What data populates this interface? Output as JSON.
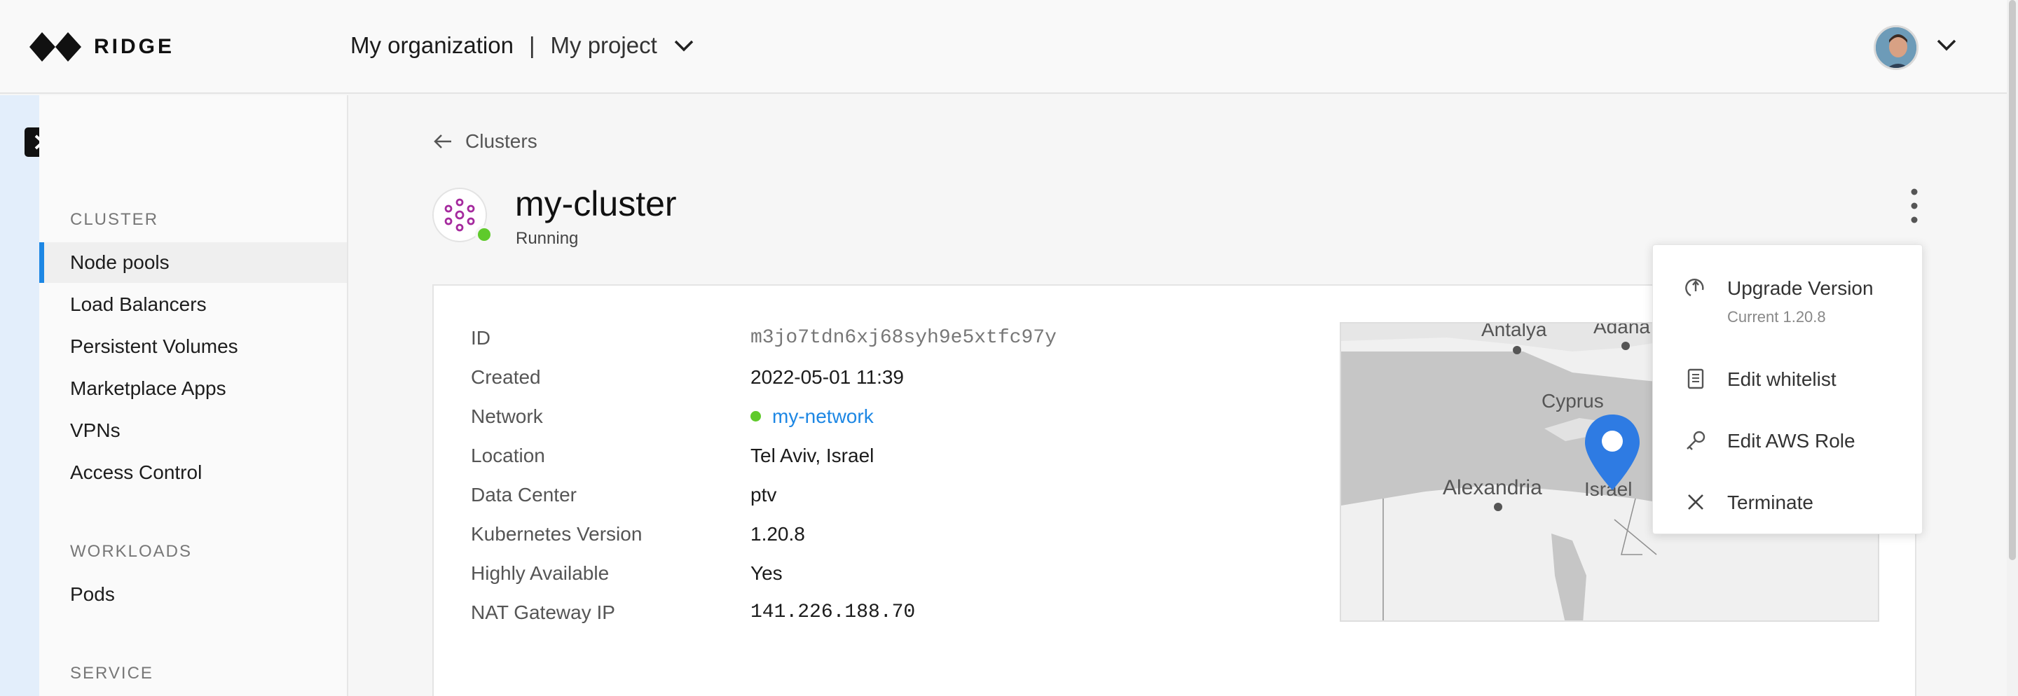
{
  "brand": {
    "name": "RIDGE"
  },
  "header": {
    "organization": "My organization",
    "separator": "|",
    "project": "My project"
  },
  "sidebar": {
    "sections": [
      {
        "title": "CLUSTER",
        "items": [
          "Node pools",
          "Load Balancers",
          "Persistent Volumes",
          "Marketplace Apps",
          "VPNs",
          "Access Control"
        ]
      },
      {
        "title": "WORKLOADS",
        "items": [
          "Pods"
        ]
      },
      {
        "title": "SERVICE",
        "items": []
      }
    ],
    "active_item": "Node pools"
  },
  "breadcrumb": {
    "back_label": "Clusters"
  },
  "cluster": {
    "name": "my-cluster",
    "status": "Running",
    "status_color": "#5fca2b"
  },
  "details": [
    {
      "label": "ID",
      "value": "m3jo7tdn6xj68syh9e5xtfc97y"
    },
    {
      "label": "Created",
      "value": "2022-05-01 11:39"
    },
    {
      "label": "Network",
      "value": "my-network"
    },
    {
      "label": "Location",
      "value": "Tel Aviv, Israel"
    },
    {
      "label": "Data Center",
      "value": "ptv"
    },
    {
      "label": "Kubernetes Version",
      "value": "1.20.8"
    },
    {
      "label": "Highly Available",
      "value": "Yes"
    },
    {
      "label": "NAT Gateway IP",
      "value": "141.226.188.70"
    }
  ],
  "map": {
    "labels": [
      "Antalya",
      "Adana",
      "Cyprus",
      "Alexandria",
      "Israel"
    ],
    "marker_color": "#2e7be3"
  },
  "menu": {
    "items": [
      {
        "label": "Upgrade Version",
        "sub": "Current 1.20.8",
        "icon": "upgrade-icon"
      },
      {
        "label": "Edit whitelist",
        "icon": "document-icon"
      },
      {
        "label": "Edit AWS Role",
        "icon": "key-icon"
      },
      {
        "label": "Terminate",
        "icon": "close-icon"
      }
    ]
  },
  "colors": {
    "accent": "#1d87e4",
    "running": "#5fca2b"
  }
}
